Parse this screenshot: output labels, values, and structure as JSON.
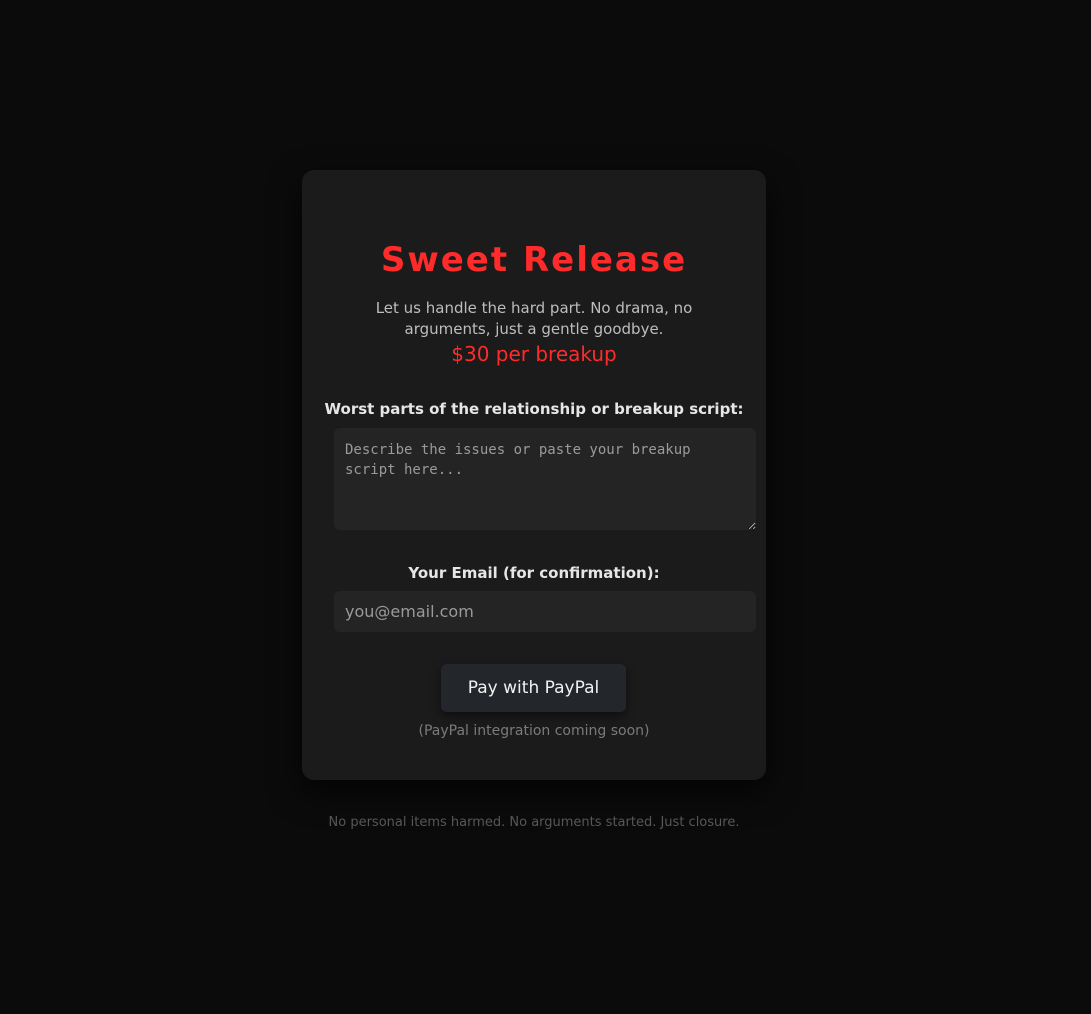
{
  "card": {
    "title": "Sweet Release",
    "tagline": "Let us handle the hard part. No drama, no arguments, just a gentle goodbye.",
    "price": "$30 per breakup",
    "script_label": "Worst parts of the relationship or breakup script:",
    "script_placeholder": "Describe the issues or paste your breakup script here...",
    "email_label": "Your Email (for confirmation):",
    "email_placeholder": "you@email.com",
    "paypal_button": "Pay with PayPal",
    "paypal_note": "(PayPal integration coming soon)"
  },
  "footer": {
    "text": "No personal items harmed. No arguments started. Just closure."
  },
  "colors": {
    "accent": "#ff2b2b",
    "background": "#0b0b0b",
    "card": "#1b1b1b",
    "input": "#242424",
    "button": "#23272b"
  }
}
